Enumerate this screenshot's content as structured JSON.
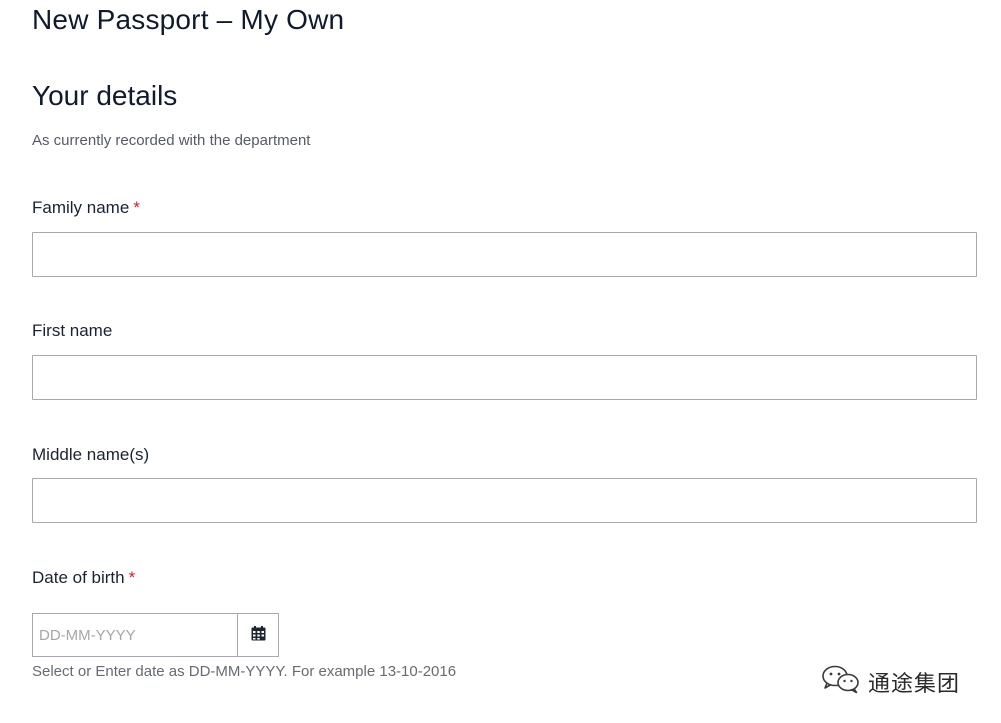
{
  "page": {
    "title": "New Passport – My Own"
  },
  "section": {
    "title": "Your details",
    "subtitle": "As currently recorded with the department"
  },
  "fields": {
    "family_name": {
      "label": "Family name",
      "required_mark": "*",
      "value": ""
    },
    "first_name": {
      "label": "First name",
      "value": ""
    },
    "middle_names": {
      "label": "Middle name(s)",
      "value": ""
    },
    "date_of_birth": {
      "label": "Date of birth",
      "required_mark": "*",
      "placeholder": "DD-MM-YYYY",
      "value": "",
      "help": "Select or Enter date as DD-MM-YYYY. For example 13-10-2016",
      "calendar_icon": "calendar-icon"
    }
  },
  "watermark": {
    "text": "通途集团",
    "icon": "wechat-icon"
  }
}
